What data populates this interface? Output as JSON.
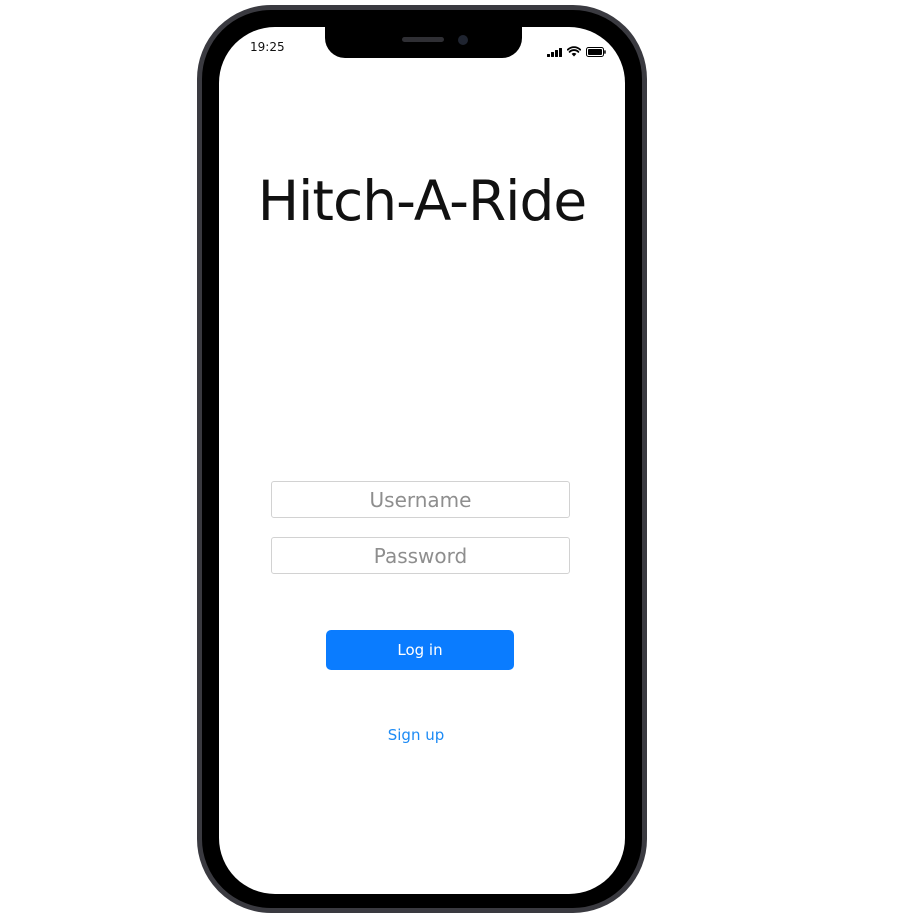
{
  "status_bar": {
    "time": "19:25",
    "icons": [
      "signal-icon",
      "wifi-icon",
      "battery-icon"
    ]
  },
  "app": {
    "title": "Hitch-A-Ride"
  },
  "login_form": {
    "username_placeholder": "Username",
    "username_value": "",
    "password_placeholder": "Password",
    "password_value": "",
    "login_label": "Log in",
    "signup_label": "Sign up"
  },
  "colors": {
    "accent": "#0a7cff",
    "link": "#1d8bf5",
    "frame": "#3a3a40"
  }
}
